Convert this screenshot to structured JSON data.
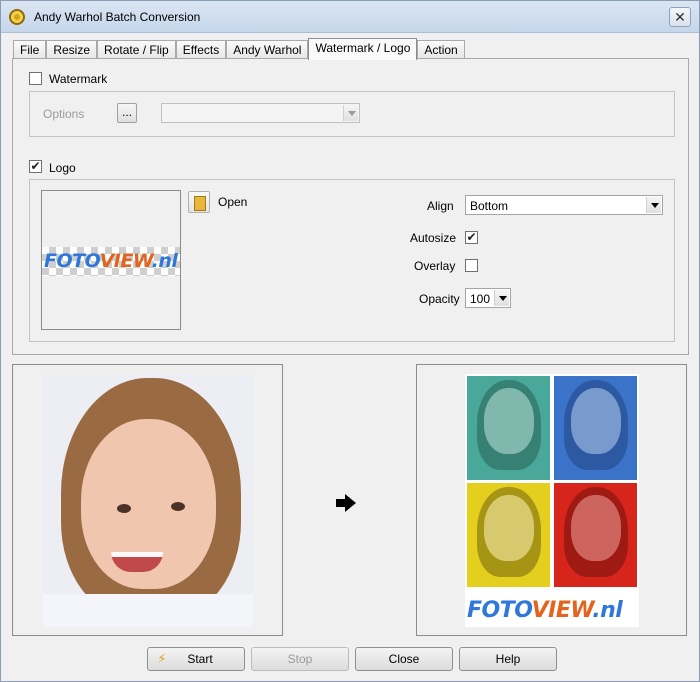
{
  "window": {
    "title": "Andy Warhol Batch Conversion",
    "close_glyph": "✕"
  },
  "tabs": [
    {
      "label": "File"
    },
    {
      "label": "Resize"
    },
    {
      "label": "Rotate / Flip"
    },
    {
      "label": "Effects"
    },
    {
      "label": "Andy Warhol"
    },
    {
      "label": "Watermark / Logo",
      "active": true
    },
    {
      "label": "Action"
    }
  ],
  "watermark": {
    "label": "Watermark",
    "checked": false,
    "options_label": "Options",
    "ellipsis_label": "...",
    "select_value": ""
  },
  "logo": {
    "label": "Logo",
    "checked": true,
    "open_label": "Open",
    "preview_text_part1": "FOTO",
    "preview_text_part2": "VIEW",
    "preview_text_part3": ".nl",
    "align_label": "Align",
    "align_value": "Bottom",
    "autosize_label": "Autosize",
    "autosize_checked": true,
    "overlay_label": "Overlay",
    "overlay_checked": false,
    "opacity_label": "Opacity",
    "opacity_value": "100"
  },
  "result_logo": {
    "part1": "FOTO",
    "part2": "VIEW",
    "part3": ".nl"
  },
  "buttons": {
    "start": "Start",
    "stop": "Stop",
    "close": "Close",
    "help": "Help"
  },
  "colors": {
    "warhol_q1": "#4aa89a",
    "warhol_q2": "#3b73c9",
    "warhol_q3": "#e4cf1e",
    "warhol_q4": "#d8251b"
  }
}
